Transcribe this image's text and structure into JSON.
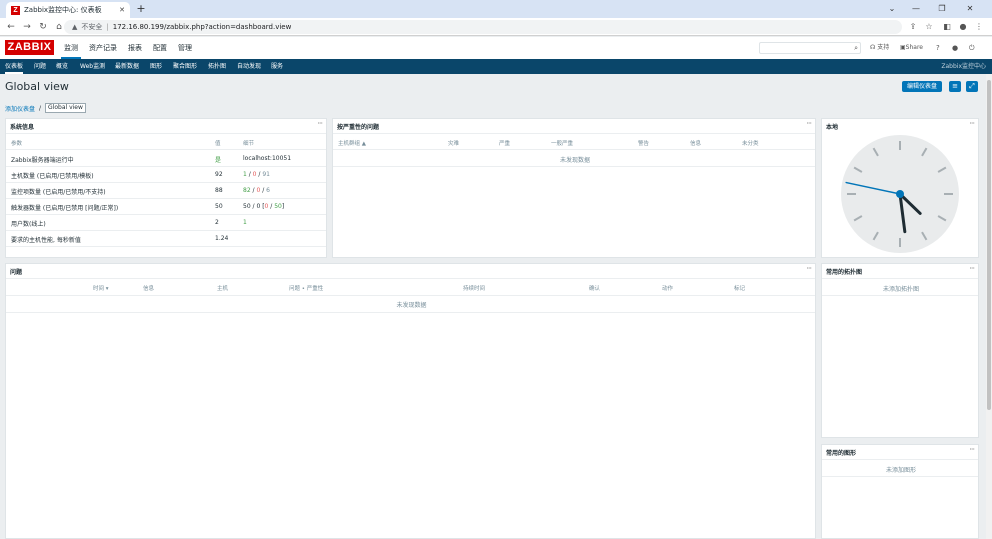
{
  "browser": {
    "tab_title": "Zabbix监控中心: 仪表板",
    "address_insecure": "不安全",
    "url": "172.16.80.199/zabbix.php?action=dashboard.view"
  },
  "header": {
    "logo": "ZABBIX",
    "menu": [
      "监测",
      "资产记录",
      "报表",
      "配置",
      "管理"
    ],
    "support": "支持",
    "share": "Share",
    "help": "?"
  },
  "subnav": {
    "items": [
      "仪表板",
      "问题",
      "概览",
      "Web监测",
      "最新数据",
      "图形",
      "聚合图形",
      "拓扑图",
      "自动发现",
      "服务"
    ],
    "right_text": "Zabbix监控中心"
  },
  "page": {
    "title": "Global view",
    "edit_button": "编辑仪表盘",
    "breadcrumb": [
      "添加仪表盘",
      "Global view"
    ]
  },
  "system_info": {
    "title": "系统信息",
    "columns": [
      "参数",
      "值",
      "细节"
    ],
    "rows": [
      {
        "param": "Zabbix服务器端运行中",
        "value": "是",
        "detail": "localhost:10051"
      },
      {
        "param": "主机数量 (已启用/已禁用/模板)",
        "value": "92",
        "detail_parts": [
          "1",
          " / ",
          "0",
          " / ",
          "91"
        ]
      },
      {
        "param": "监控项数量 (已启用/已禁用/不支持)",
        "value": "88",
        "detail_parts": [
          "82",
          " / ",
          "0",
          " / ",
          "6"
        ]
      },
      {
        "param": "触发器数量 (已启用/已禁用 [问题/正常])",
        "value": "50",
        "detail_parts": [
          "50 / 0 [",
          "0",
          " / ",
          "50",
          "]"
        ]
      },
      {
        "param": "用户数(线上)",
        "value": "2",
        "detail": "1"
      },
      {
        "param": "要求的主机性能, 每秒新值",
        "value": "1.24",
        "detail": ""
      }
    ]
  },
  "problems_by_severity": {
    "title": "按严重性的问题",
    "columns": [
      "主机群组 ▲",
      "灾难",
      "严重",
      "一般严重",
      "警告",
      "信息",
      "未分类"
    ],
    "no_data": "未发现数据"
  },
  "clock": {
    "title": "本地",
    "hour": 4,
    "minute": 28,
    "second": 47
  },
  "problems": {
    "title": "问题",
    "columns": [
      "时间 ▾",
      "信息",
      "主机",
      "问题 • 严重性",
      "持续时间",
      "确认",
      "动作",
      "标记"
    ],
    "no_data": "未发现数据"
  },
  "fav_maps": {
    "title": "常用的拓扑图",
    "empty": "未添加拓扑图"
  },
  "fav_graphs": {
    "title": "常用的图形",
    "empty": "未添加图形"
  },
  "widget_menu": "···",
  "colors": {
    "zabbix_red": "#d40000",
    "nav_dark": "#0a466a",
    "accent_blue": "#0275b8",
    "ok_green": "#429e47"
  }
}
